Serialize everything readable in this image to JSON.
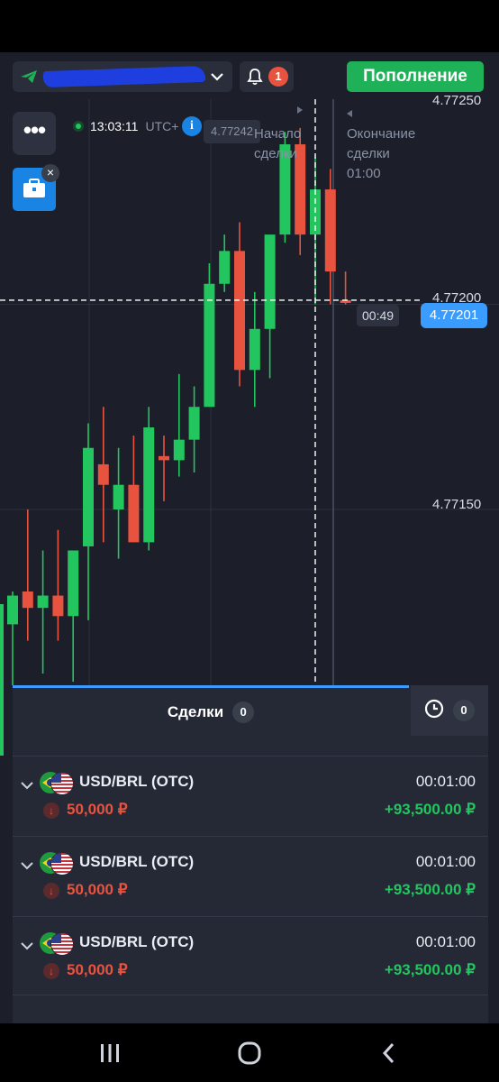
{
  "header": {
    "deposit_label": "Пополнение",
    "notifications_count": "1",
    "account_name_redacted": true
  },
  "chart": {
    "clock": "13:03:11",
    "timezone": "UTC+",
    "hover_price": "4.77242",
    "trade_start_label": "Начало сделки",
    "trade_end_label": "Окончание сделки",
    "trade_end_time": "01:00",
    "countdown": "00:49",
    "current_price": "4.77201",
    "price_axis": [
      "4.77250",
      "4.77200",
      "4.77150"
    ],
    "candles": [
      {
        "o": 4.77122,
        "h": 4.7713,
        "l": 4.771,
        "c": 4.77129,
        "dir": "up"
      },
      {
        "o": 4.7713,
        "h": 4.7715,
        "l": 4.77118,
        "c": 4.77126,
        "dir": "down"
      },
      {
        "o": 4.77126,
        "h": 4.7714,
        "l": 4.7711,
        "c": 4.77129,
        "dir": "up"
      },
      {
        "o": 4.77129,
        "h": 4.77145,
        "l": 4.77118,
        "c": 4.77124,
        "dir": "down"
      },
      {
        "o": 4.77124,
        "h": 4.77136,
        "l": 4.77108,
        "c": 4.7714,
        "dir": "up"
      },
      {
        "o": 4.77141,
        "h": 4.77171,
        "l": 4.77123,
        "c": 4.77165,
        "dir": "up"
      },
      {
        "o": 4.77161,
        "h": 4.77175,
        "l": 4.77142,
        "c": 4.77156,
        "dir": "down"
      },
      {
        "o": 4.77156,
        "h": 4.77165,
        "l": 4.77138,
        "c": 4.7715,
        "dir": "up"
      },
      {
        "o": 4.77156,
        "h": 4.77168,
        "l": 4.77142,
        "c": 4.77142,
        "dir": "down"
      },
      {
        "o": 4.77142,
        "h": 4.77175,
        "l": 4.7714,
        "c": 4.7717,
        "dir": "up"
      },
      {
        "o": 4.77163,
        "h": 4.77168,
        "l": 4.77152,
        "c": 4.77162,
        "dir": "down"
      },
      {
        "o": 4.77162,
        "h": 4.77183,
        "l": 4.77158,
        "c": 4.77167,
        "dir": "up"
      },
      {
        "o": 4.77167,
        "h": 4.7718,
        "l": 4.77159,
        "c": 4.77175,
        "dir": "up"
      },
      {
        "o": 4.77175,
        "h": 4.7721,
        "l": 4.77175,
        "c": 4.77205,
        "dir": "up"
      },
      {
        "o": 4.77205,
        "h": 4.77217,
        "l": 4.77203,
        "c": 4.77213,
        "dir": "up"
      },
      {
        "o": 4.77213,
        "h": 4.7722,
        "l": 4.7718,
        "c": 4.77184,
        "dir": "down"
      },
      {
        "o": 4.77184,
        "h": 4.77203,
        "l": 4.77175,
        "c": 4.77194,
        "dir": "up"
      },
      {
        "o": 4.77194,
        "h": 4.77215,
        "l": 4.77182,
        "c": 4.77217,
        "dir": "up"
      },
      {
        "o": 4.77217,
        "h": 4.77242,
        "l": 4.77215,
        "c": 4.77239,
        "dir": "up"
      },
      {
        "o": 4.77239,
        "h": 4.77243,
        "l": 4.77212,
        "c": 4.77217,
        "dir": "down"
      },
      {
        "o": 4.77217,
        "h": 4.77236,
        "l": 4.772,
        "c": 4.77228,
        "dir": "up"
      },
      {
        "o": 4.77228,
        "h": 4.77233,
        "l": 4.772,
        "c": 4.77208,
        "dir": "down"
      },
      {
        "o": 4.77201,
        "h": 4.77208,
        "l": 4.772,
        "c": 4.77201,
        "dir": "down"
      }
    ]
  },
  "colors": {
    "up": "#22c55e",
    "down": "#e8533f",
    "accent": "#3b9cff",
    "panel": "#252936"
  },
  "deals_panel": {
    "tab_label": "Сделки",
    "tab_count": "0",
    "history_count": "0",
    "trades": [
      {
        "pair": "USD/BRL (OTC)",
        "duration": "00:01:00",
        "amount": "50,000 ₽",
        "profit": "+93,500.00 ₽",
        "direction": "down"
      },
      {
        "pair": "USD/BRL (OTC)",
        "duration": "00:01:00",
        "amount": "50,000 ₽",
        "profit": "+93,500.00 ₽",
        "direction": "down"
      },
      {
        "pair": "USD/BRL (OTC)",
        "duration": "00:01:00",
        "amount": "50,000 ₽",
        "profit": "+93,500.00 ₽",
        "direction": "down"
      }
    ]
  }
}
